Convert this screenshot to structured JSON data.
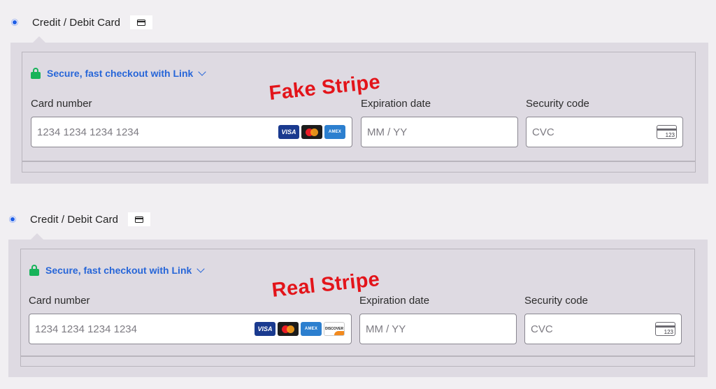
{
  "sections": [
    {
      "payment_option": {
        "label": "Credit / Debit Card",
        "selected": true,
        "icon": "credit-card-icon"
      },
      "link": {
        "text": "Secure, fast checkout with Link",
        "lock_icon": "lock-icon",
        "chevron_icon": "chevron-down-icon",
        "accent_color": "#2766d8"
      },
      "card_number": {
        "label": "Card number",
        "placeholder": "1234 1234 1234 1234",
        "brands": [
          "VISA",
          "mastercard",
          "AMEX"
        ]
      },
      "expiration": {
        "label": "Expiration date",
        "placeholder": "MM / YY"
      },
      "security_code": {
        "label": "Security code",
        "placeholder": "CVC",
        "icon_text": "123"
      },
      "annotation": "Fake Stripe"
    },
    {
      "payment_option": {
        "label": "Credit / Debit Card",
        "selected": true,
        "icon": "credit-card-icon"
      },
      "link": {
        "text": "Secure, fast checkout with Link",
        "lock_icon": "lock-icon",
        "chevron_icon": "chevron-down-icon",
        "accent_color": "#2766d8"
      },
      "card_number": {
        "label": "Card number",
        "placeholder": "1234 1234 1234 1234",
        "brands": [
          "VISA",
          "mastercard",
          "AMEX",
          "DISCOVER"
        ]
      },
      "expiration": {
        "label": "Expiration date",
        "placeholder": "MM / YY"
      },
      "security_code": {
        "label": "Security code",
        "placeholder": "CVC",
        "icon_text": "123"
      },
      "annotation": "Real Stripe"
    }
  ],
  "colors": {
    "annotation": "#e3141a",
    "radio": "#1f5ee6",
    "lock": "#17b35a"
  }
}
